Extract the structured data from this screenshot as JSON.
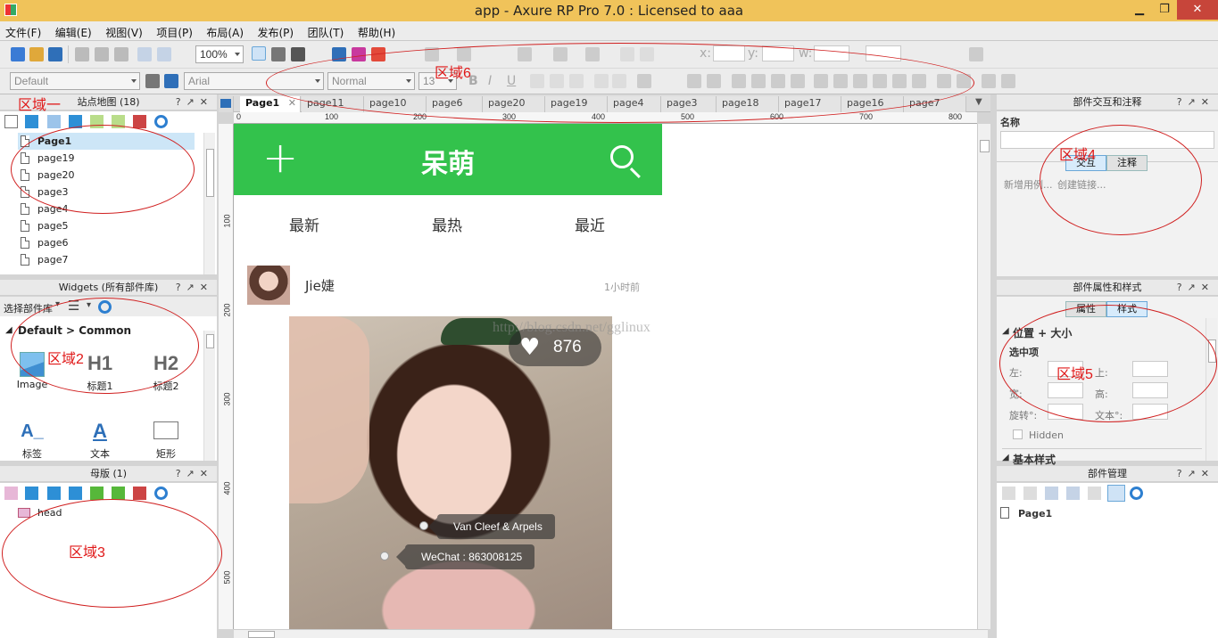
{
  "window": {
    "title": "app - Axure RP Pro 7.0 : Licensed to aaa",
    "min": "▁",
    "restore": "❐",
    "close": "✕"
  },
  "menu": [
    "文件(F)",
    "编辑(E)",
    "视图(V)",
    "项目(P)",
    "布局(A)",
    "发布(P)",
    "团队(T)",
    "帮助(H)"
  ],
  "toolbar": {
    "zoom": "100%",
    "style": "Default",
    "font": "Arial",
    "weight": "Normal",
    "size": "13",
    "bold": "B",
    "italic": "I",
    "underline": "U",
    "coord_x": "x:",
    "coord_y": "y:",
    "coord_w": "w:"
  },
  "sitemap": {
    "title": "站点地图 (18)",
    "pages": [
      "Page1",
      "page19",
      "page20",
      "page3",
      "page4",
      "page5",
      "page6",
      "page7"
    ]
  },
  "widgets": {
    "title": "Widgets (所有部件库)",
    "library_select": "选择部件库",
    "group": "Default > Common",
    "items": [
      {
        "label": "Image",
        "glyph": ""
      },
      {
        "label": "标题1",
        "glyph": "H1"
      },
      {
        "label": "标题2",
        "glyph": "H2"
      },
      {
        "label": "标签",
        "glyph": "A_"
      },
      {
        "label": "文本",
        "glyph": "A"
      },
      {
        "label": "矩形",
        "glyph": ""
      }
    ]
  },
  "masters": {
    "title": "母版 (1)",
    "items": [
      "head"
    ]
  },
  "tabs": [
    "Page1",
    "page11",
    "page10",
    "page6",
    "page20",
    "page19",
    "page4",
    "page3",
    "page18",
    "page17",
    "page16",
    "page7"
  ],
  "ruler": {
    "h": [
      "0",
      "100",
      "200",
      "300",
      "400",
      "500",
      "600",
      "700",
      "800"
    ],
    "v": [
      "100",
      "200",
      "300",
      "400",
      "500"
    ]
  },
  "canvas": {
    "brand": "呆萌",
    "plus": "+",
    "nav": [
      "最新",
      "最热",
      "最近"
    ],
    "user": "Jie婕",
    "time": "1小时前",
    "likes": "876",
    "heart": "♥",
    "tag1": "Van Cleef & Arpels",
    "tag2": "WeChat : 863008125",
    "watermark": "http://blog.csdn.net/gglinux"
  },
  "interaction_panel": {
    "title": "部件交互和注释",
    "name_label": "名称",
    "tab_interaction": "交互",
    "tab_notes": "注释",
    "new_case": "新增用例...",
    "create_link": "创建链接..."
  },
  "props_panel": {
    "title": "部件属性和样式",
    "tab_props": "属性",
    "tab_style": "样式",
    "section_pos": "位置 + 大小",
    "selected": "选中项",
    "left": "左:",
    "top": "上:",
    "width": "宽:",
    "height": "高:",
    "rotate": "旋转°:",
    "text": "文本°:",
    "hidden": "Hidden",
    "section_basic": "基本样式"
  },
  "manager_panel": {
    "title": "部件管理",
    "page": "Page1"
  },
  "annotations": [
    "区域一",
    "区域2",
    "区域3",
    "区域4",
    "区域5",
    "区域6"
  ],
  "colors": {
    "titlebar": "#f0c35a",
    "green_header": "#33c24c",
    "annotation": "#d02020",
    "selected_row": "#cde6f7"
  }
}
